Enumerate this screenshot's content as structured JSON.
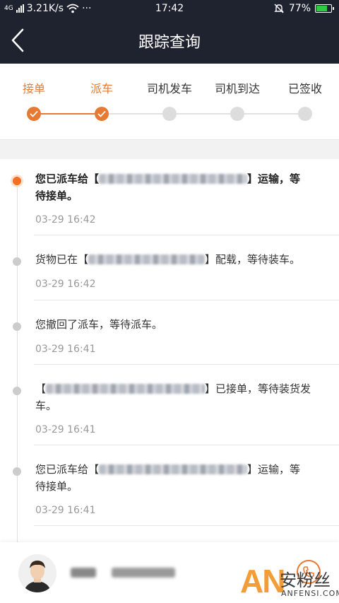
{
  "status_bar": {
    "network": "4G",
    "speed": "3.21K/s",
    "more": "···",
    "time": "17:42",
    "battery": "77%",
    "battery_level": 0.77
  },
  "header": {
    "title": "跟踪查询",
    "back_icon": "back-arrow-icon"
  },
  "progress": {
    "accent": "#e67a32",
    "steps": [
      {
        "label": "接单",
        "done": true
      },
      {
        "label": "派车",
        "done": true
      },
      {
        "label": "司机发车",
        "done": false
      },
      {
        "label": "司机到达",
        "done": false
      },
      {
        "label": "已签收",
        "done": false
      }
    ]
  },
  "timeline": {
    "items": [
      {
        "pre": "您已派车给",
        "post": "运输，等",
        "line2": "待接单。",
        "time": "03-29 16:42"
      },
      {
        "pre": "货物已在",
        "post": "配载，等待装车。",
        "time": "03-29 16:42"
      },
      {
        "text": "您撤回了派车，等待派车。",
        "time": "03-29 16:41"
      },
      {
        "post": "已接单，等待装货发",
        "line2": "车。",
        "time": "03-29 16:41"
      },
      {
        "pre": "您已派车给",
        "post": "运输，等",
        "line2": "待接单。",
        "time": "03-29 16:41"
      }
    ]
  },
  "bottom": {
    "phone_icon": "phone-icon"
  },
  "watermark": {
    "an": "AN",
    "cn": "安粉丝",
    "en": "ANFENSI.COM"
  }
}
